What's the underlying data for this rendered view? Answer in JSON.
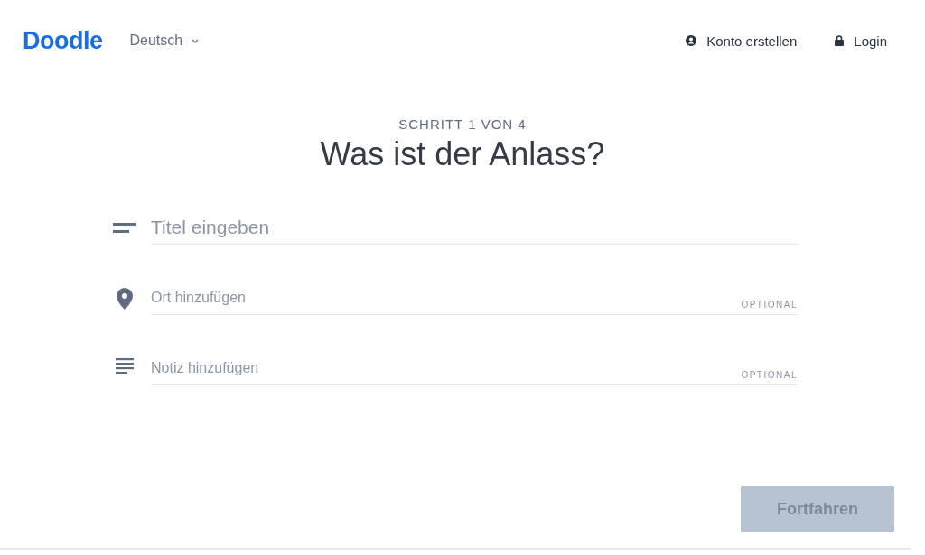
{
  "header": {
    "logo": "Doodle",
    "language": "Deutsch",
    "links": [
      {
        "kind": "account",
        "label": "Konto erstellen"
      },
      {
        "kind": "login",
        "label": "Login"
      }
    ]
  },
  "step": "SCHRITT 1 VON 4",
  "heading": "Was ist der Anlass?",
  "fields": [
    {
      "kind": "title",
      "placeholder": "Titel eingeben",
      "optional": false
    },
    {
      "kind": "location",
      "placeholder": "Ort hinzufügen",
      "optional": true,
      "optional_label": "OPTIONAL"
    },
    {
      "kind": "note",
      "placeholder": "Notiz hinzufügen",
      "optional": true,
      "optional_label": "OPTIONAL"
    }
  ],
  "continue_button": {
    "label": "Fortfahren",
    "disabled": true
  }
}
